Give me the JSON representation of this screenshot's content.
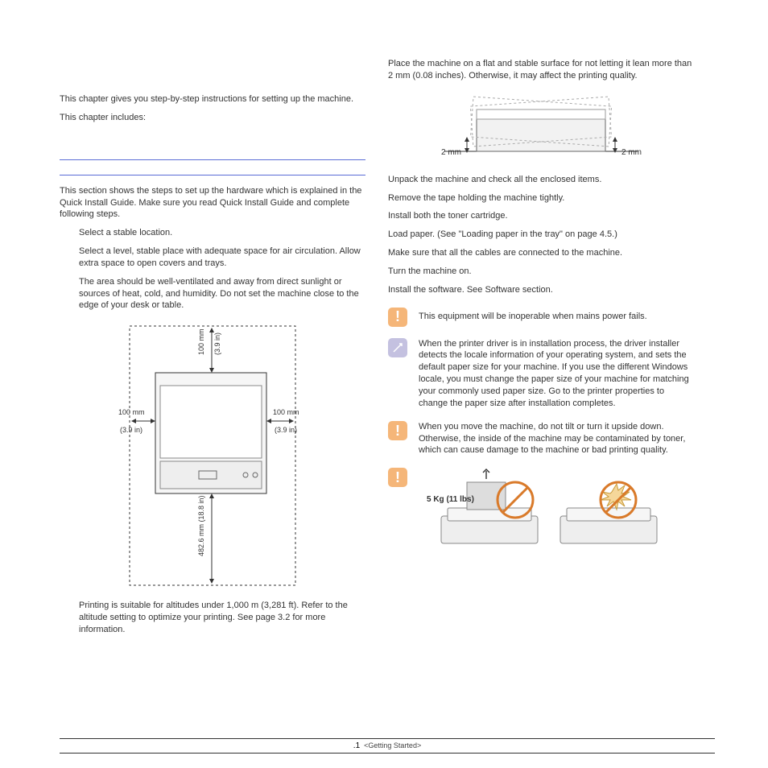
{
  "left": {
    "intro1": "This chapter gives you step-by-step instructions for setting up the machine.",
    "intro2": "This chapter includes:",
    "section_intro": "This section shows the steps to set up the hardware which is explained in the Quick Install Guide. Make sure you read Quick Install Guide and complete following steps.",
    "step_location": "Select a stable location.",
    "step_location_detail": "Select a level, stable place with adequate space for air circulation. Allow extra space to open covers and trays.",
    "step_ventilation": "The area should be well-ventilated and away from direct sunlight or sources of heat, cold, and humidity. Do not set the machine close to the edge of your desk or table.",
    "altitude": "Printing is suitable for altitudes under 1,000 m (3,281 ft). Refer to the altitude setting to optimize your printing. See page 3.2 for more information.",
    "dims": {
      "top": "100 mm",
      "top_in": "(3.9 in)",
      "left": "100 mm",
      "left_in": "(3.9 in)",
      "right": "100 mm",
      "right_in": "(3.9 in)",
      "front": "482.6 mm (18.8 in)"
    }
  },
  "right": {
    "flat_surface": "Place the machine on a flat and stable surface for not letting it lean more than 2 mm (0.08 inches). Otherwise, it may affect the printing quality.",
    "lean_left": "2 mm",
    "lean_right": "2 mm",
    "s_unpack": "Unpack the machine and check all the enclosed items.",
    "s_tape": "Remove the tape holding the machine tightly.",
    "s_toner": "Install both the toner cartridge.",
    "s_paper": "Load paper. (See \"Loading paper in the tray\" on page 4.5.)",
    "s_cables": "Make sure that all the cables are connected to the machine.",
    "s_power": "Turn the machine on.",
    "s_software": "Install the software. See Software section.",
    "warn_inop": "This equipment will be inoperable when mains power fails.",
    "note_driver": "When the printer driver is in installation process, the driver installer detects the locale information of your operating system, and sets the default paper size for your machine. If you use the different Windows locale, you must change the paper size of your machine for matching your commonly used paper size. Go to the printer properties to change the paper size after installation completes.",
    "warn_tilt": "When you move the machine, do not tilt or turn it upside down. Otherwise, the inside of the machine may be contaminated by toner, which can cause damage to the machine or bad printing quality.",
    "weight": "5 Kg (11 lbs)"
  },
  "footer": {
    "page": ".1",
    "section": "<Getting Started>"
  }
}
